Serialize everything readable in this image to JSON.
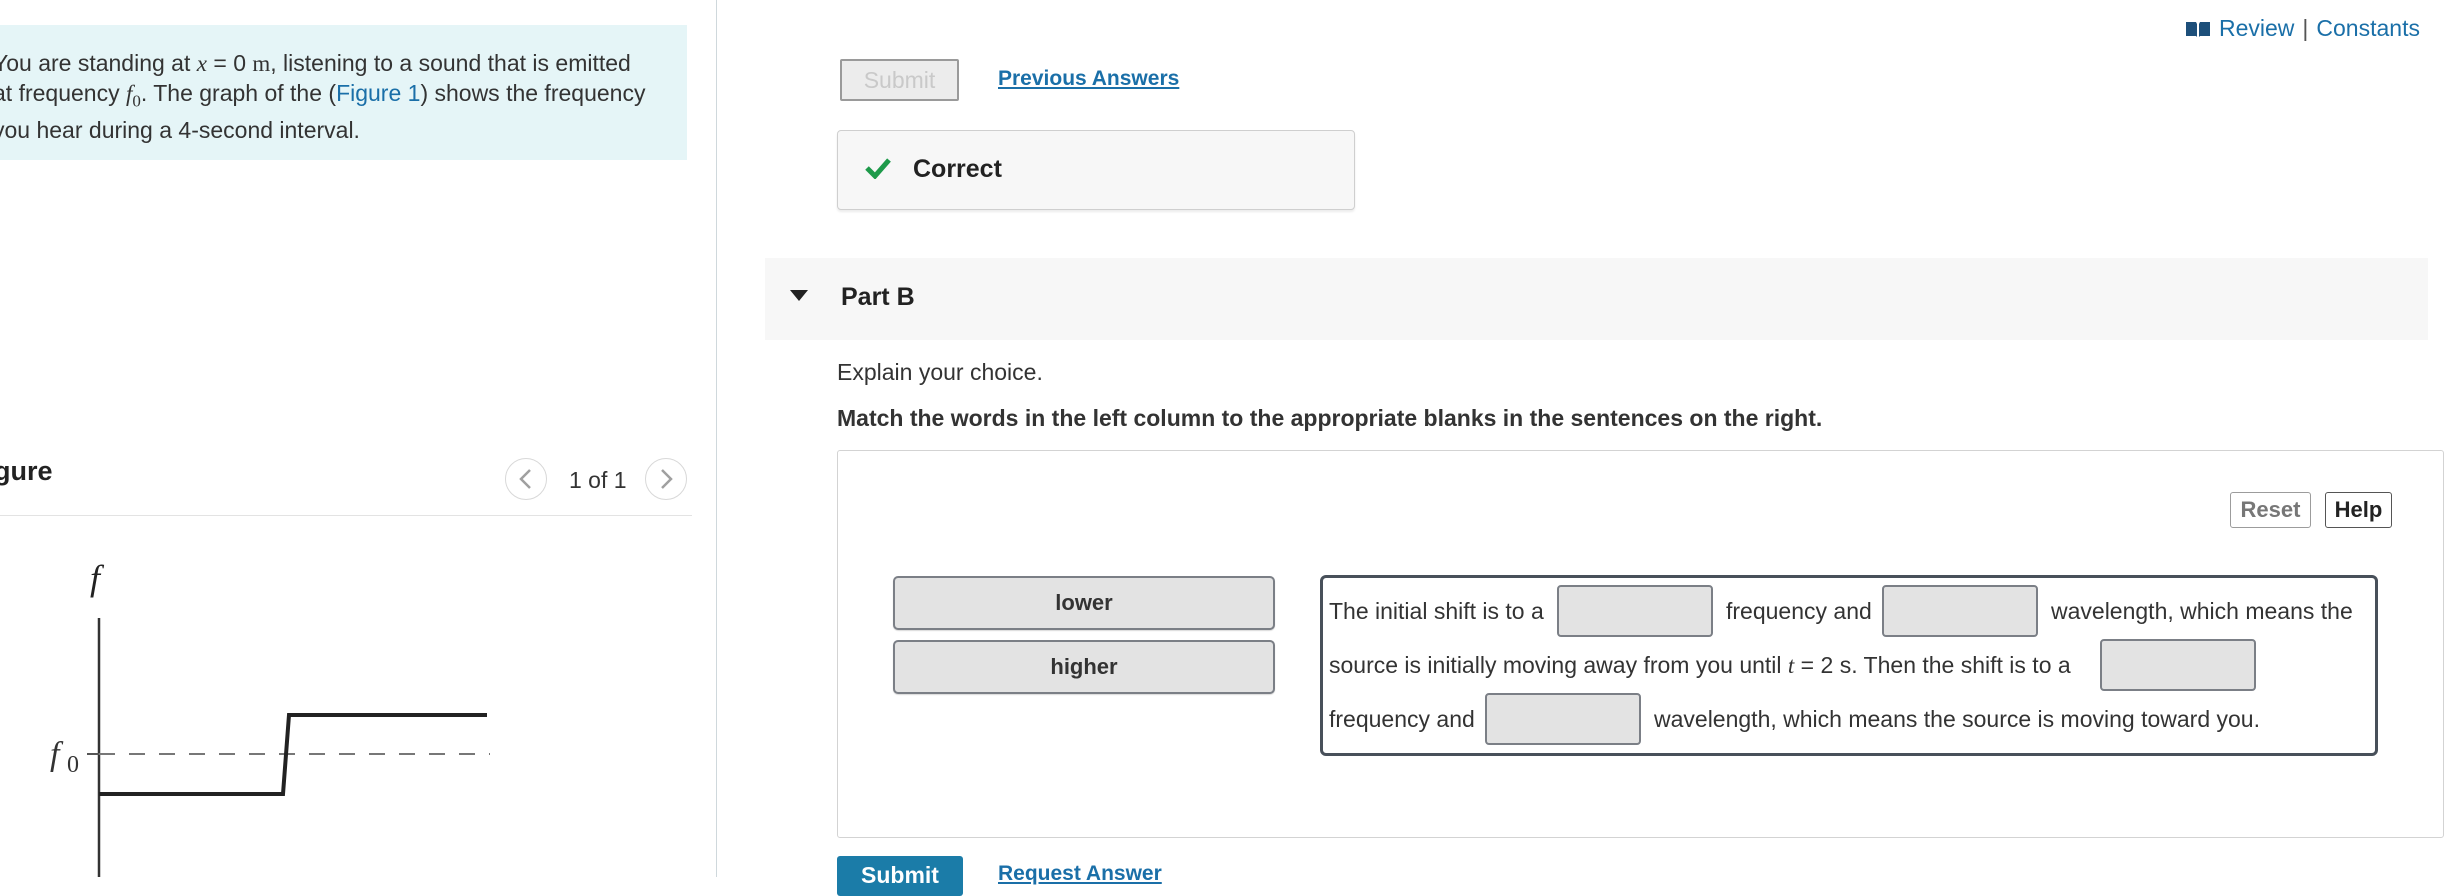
{
  "problem": {
    "intro_parts": {
      "p1": "You are standing at ",
      "var_x": "x",
      "eq": " = 0 ",
      "unit_m": "m",
      "p2": ", listening to a sound that is emitted",
      "p3": "at frequency ",
      "var_f0": "f",
      "sub0": "0",
      "p4": ". The graph of the (",
      "figure_link": "Figure 1",
      "p5": ") shows the frequency",
      "p6": "you hear during a 4-second interval."
    }
  },
  "figure": {
    "title": "gure",
    "counter": "1 of 1",
    "axis_label_f": "f",
    "axis_label_f0": "f",
    "axis_label_f0_sub": "0"
  },
  "header": {
    "review": "Review",
    "separator": "|",
    "constants": "Constants"
  },
  "part_a": {
    "submit_label": "Submit",
    "previous_answers": "Previous Answers",
    "feedback": "Correct"
  },
  "part_b": {
    "title": "Part B",
    "prompt": "Explain your choice.",
    "instruction": "Match the words in the left column to the appropriate blanks in the sentences on the right.",
    "reset_label": "Reset",
    "help_label": "Help",
    "options": [
      "lower",
      "higher"
    ],
    "sentence": {
      "s1": "The initial shift is to a",
      "s2": "frequency and",
      "s3": "wavelength, which means the",
      "s4": "source is initially moving away from you until ",
      "var_t": "t",
      "s5": " = 2 s. Then the shift is to a",
      "s6": "frequency and",
      "s7": "wavelength, which means the source is moving toward you."
    },
    "submit_label": "Submit",
    "request_answer": "Request Answer"
  },
  "colors": {
    "accent": "#1a6fa8",
    "correct_green": "#1e9a4a",
    "intro_bg": "#e5f5f7",
    "submit_bg": "#1b7ca8"
  },
  "icons": {
    "review": "book-icon",
    "feedback": "checkmark-icon",
    "collapse": "caret-down-icon",
    "prev": "chevron-left-icon",
    "next": "chevron-right-icon"
  }
}
